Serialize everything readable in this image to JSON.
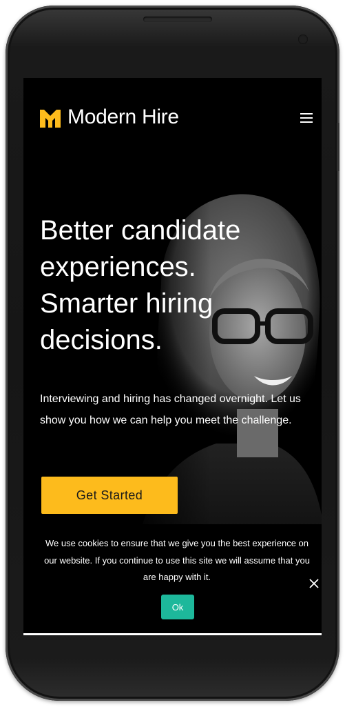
{
  "header": {
    "brand_name": "Modern Hire"
  },
  "hero": {
    "headline_lines": [
      "Better candidate",
      "experiences.",
      "Smarter hiring",
      "decisions."
    ],
    "subtext": "Interviewing and hiring has changed overnight. Let us show you how we can help you meet the challenge.",
    "cta_label": "Get Started"
  },
  "cookie_banner": {
    "message": "We use cookies to ensure that we give you the best experience on our website. If you continue to use this site we will assume that you are happy with it.",
    "ok_label": "Ok"
  },
  "icons": {
    "logo": "modern-hire-logo-icon",
    "menu": "hamburger-menu-icon",
    "close": "close-icon"
  },
  "colors": {
    "accent": "#fdbb1c",
    "cookie_ok": "#1db89b",
    "screen_background": "#000000",
    "text": "#ffffff"
  }
}
